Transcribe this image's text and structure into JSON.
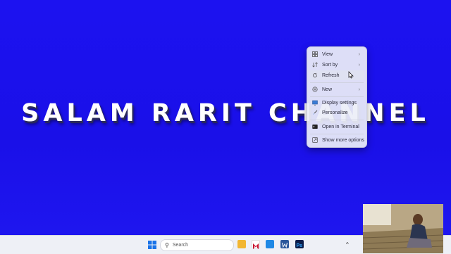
{
  "desktop": {
    "banner_text": "SALAM RARIT CHANNEL",
    "background_color": "#1c12f0"
  },
  "context_menu": {
    "items": [
      {
        "label": "View",
        "icon": "grid-icon",
        "has_submenu": true
      },
      {
        "label": "Sort by",
        "icon": "sort-icon",
        "has_submenu": true
      },
      {
        "label": "Refresh",
        "icon": "refresh-icon",
        "has_submenu": false
      },
      {
        "label": "New",
        "icon": "plus-circle-icon",
        "has_submenu": true
      },
      {
        "label": "Display settings",
        "icon": "display-icon",
        "has_submenu": false
      },
      {
        "label": "Personalize",
        "icon": "brush-icon",
        "has_submenu": false
      },
      {
        "label": "Open in Terminal",
        "icon": "terminal-icon",
        "has_submenu": false
      },
      {
        "label": "Show more options",
        "icon": "more-options-icon",
        "has_submenu": false
      }
    ],
    "chevron": "›"
  },
  "taskbar": {
    "search_placeholder": "Search",
    "apps": [
      {
        "name": "start",
        "color": "#1a73e8"
      },
      {
        "name": "file-explorer",
        "color": "#f2b632"
      },
      {
        "name": "mcafee",
        "color": "#c8102e"
      },
      {
        "name": "app-blue",
        "color": "#1e88e5"
      },
      {
        "name": "word",
        "color": "#2b579a"
      },
      {
        "name": "photoshop",
        "color": "#0b1d4a"
      }
    ],
    "tray_caret": "^"
  }
}
